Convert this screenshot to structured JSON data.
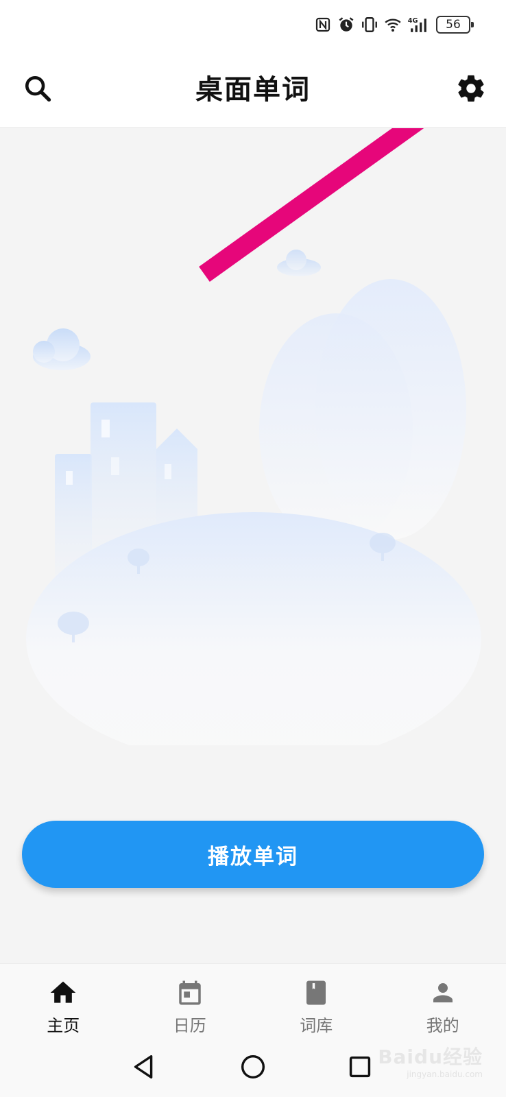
{
  "status_bar": {
    "battery_level": "56",
    "icons": [
      "nfc-icon",
      "alarm-icon",
      "vibrate-icon",
      "wifi-icon",
      "signal-4g-icon"
    ]
  },
  "app_bar": {
    "title": "桌面单词",
    "left_icon": "search-icon",
    "right_icon": "gear-icon"
  },
  "main": {
    "play_button_label": "播放单词"
  },
  "bottom_nav": {
    "items": [
      {
        "label": "主页",
        "icon": "home-icon",
        "active": true
      },
      {
        "label": "日历",
        "icon": "calendar-icon",
        "active": false
      },
      {
        "label": "词库",
        "icon": "book-icon",
        "active": false
      },
      {
        "label": "我的",
        "icon": "person-icon",
        "active": false
      }
    ]
  },
  "system_nav": {
    "icons": [
      "back-icon",
      "home-circle-icon",
      "recents-icon"
    ]
  },
  "watermark": {
    "logo": "Baidu经验",
    "site": "jingyan.baidu.com"
  },
  "colors": {
    "accent": "#2196f3",
    "annotation_arrow": "#e6067a",
    "background": "#f4f4f4"
  }
}
